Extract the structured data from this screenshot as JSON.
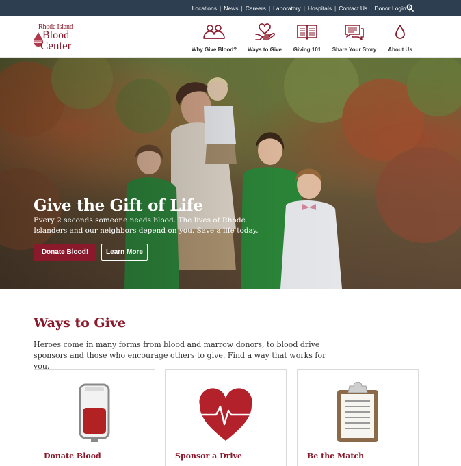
{
  "topbar": {
    "links": [
      "Locations",
      "News",
      "Careers",
      "Laboratory",
      "Hospitals",
      "Contact Us",
      "Donor Login"
    ]
  },
  "logo": {
    "line1": "Rhode Island",
    "line2": "Blood",
    "line3": "Center"
  },
  "nav": {
    "items": [
      {
        "label": "Why Give Blood?",
        "icon": "people-hands-icon"
      },
      {
        "label": "Ways to Give",
        "icon": "heart-hand-icon"
      },
      {
        "label": "Giving 101",
        "icon": "book-icon"
      },
      {
        "label": "Share Your Story",
        "icon": "chat-icon"
      },
      {
        "label": "About Us",
        "icon": "blood-drop-icon"
      }
    ]
  },
  "hero": {
    "title": "Give the Gift of Life",
    "text": "Every 2 seconds someone needs blood. The lives of Rhode Islanders and our neighbors depend on you. Save a life today.",
    "primary_button": "Donate Blood!",
    "secondary_button": "Learn More"
  },
  "ways_to_give": {
    "title": "Ways to Give",
    "intro": "Heroes come in many forms from blood and marrow donors, to blood drive sponsors and those who encourage others to give. Find a way that works for you.",
    "cards": [
      {
        "title": "Donate Blood",
        "icon": "blood-bag-icon"
      },
      {
        "title": "Sponsor a Drive",
        "icon": "heartbeat-icon"
      },
      {
        "title": "Be the Match",
        "icon": "clipboard-icon"
      }
    ]
  },
  "colors": {
    "brand": "#8a1a2b",
    "topbar": "#2c3e50"
  }
}
